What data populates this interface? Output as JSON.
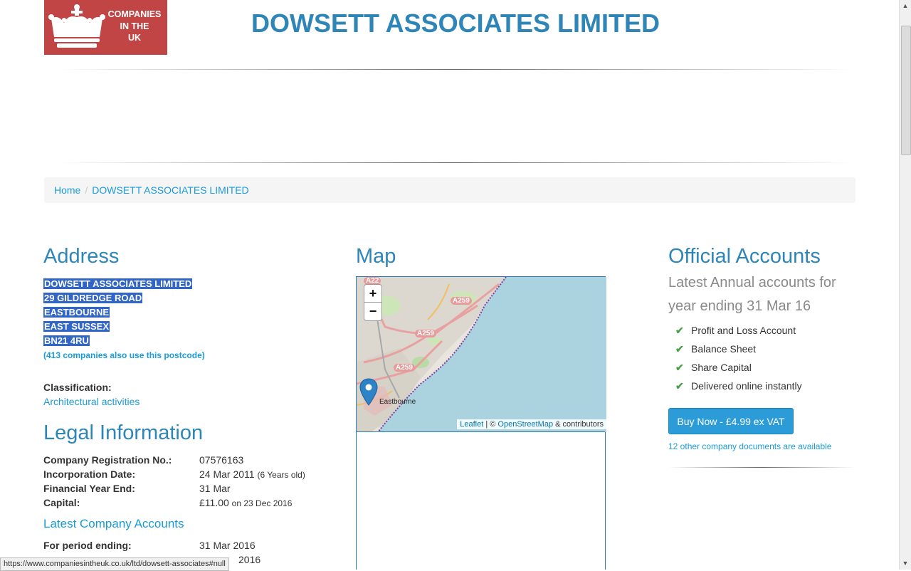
{
  "header": {
    "logo_line1": "COMPANIES",
    "logo_line2": "IN THE",
    "logo_line3": "UK",
    "site_title": "DOWSETT ASSOCIATES LIMITED"
  },
  "breadcrumb": {
    "home": "Home",
    "current": "DOWSETT ASSOCIATES LIMITED"
  },
  "address": {
    "heading": "Address",
    "lines": [
      "DOWSETT ASSOCIATES LIMITED",
      "29 GILDREDGE ROAD",
      "EASTBOURNE",
      "EAST SUSSEX",
      "BN21 4RU"
    ],
    "postcode_link": "(413 companies also use this postcode)",
    "classification_label": "Classification:",
    "classification_value": "Architectural activities"
  },
  "legal": {
    "heading": "Legal Information",
    "rows": [
      {
        "label": "Company Registration No.:",
        "value": "07576163",
        "note": ""
      },
      {
        "label": "Incorporation Date:",
        "value": "24 Mar 2011",
        "note": "(6 Years old)"
      },
      {
        "label": "Financial Year End:",
        "value": "31 Mar",
        "note": ""
      },
      {
        "label": "Capital:",
        "value": "£11.00",
        "note": "on 23 Dec 2016"
      }
    ],
    "latest_accounts_heading": "Latest Company Accounts",
    "period_label": "For period ending:",
    "period_value": "31 Mar 2016",
    "filed_value": "2016"
  },
  "map": {
    "heading": "Map",
    "zoom_in": "+",
    "zoom_out": "−",
    "road_labels": [
      "A22",
      "A259",
      "A259",
      "A259"
    ],
    "place_label": "Eastbourne",
    "attribution_leaflet": "Leaflet",
    "attribution_sep": " | © ",
    "attribution_osm": "OpenStreetMap",
    "attribution_tail": " & contributors"
  },
  "accounts": {
    "heading": "Official Accounts",
    "sub_line1": "Latest Annual accounts for",
    "sub_line2": "year ending 31 Mar 16",
    "features": [
      "Profit and Loss Account",
      "Balance Sheet",
      "Share Capital",
      "Delivered online instantly"
    ],
    "buy_button": "Buy Now - £4.99 ex VAT",
    "other_docs": "12 other company documents are available"
  },
  "status_bar": {
    "url": "https://www.companiesintheuk.co.uk/ltd/dowsett-associates#null"
  },
  "colors": {
    "brand_red": "#c24545",
    "title_blue": "#2e86b8",
    "link_blue": "#1a9bd7",
    "button_blue": "#2b9cd8",
    "selection": "#3166c7",
    "sea": "#aad3df"
  }
}
